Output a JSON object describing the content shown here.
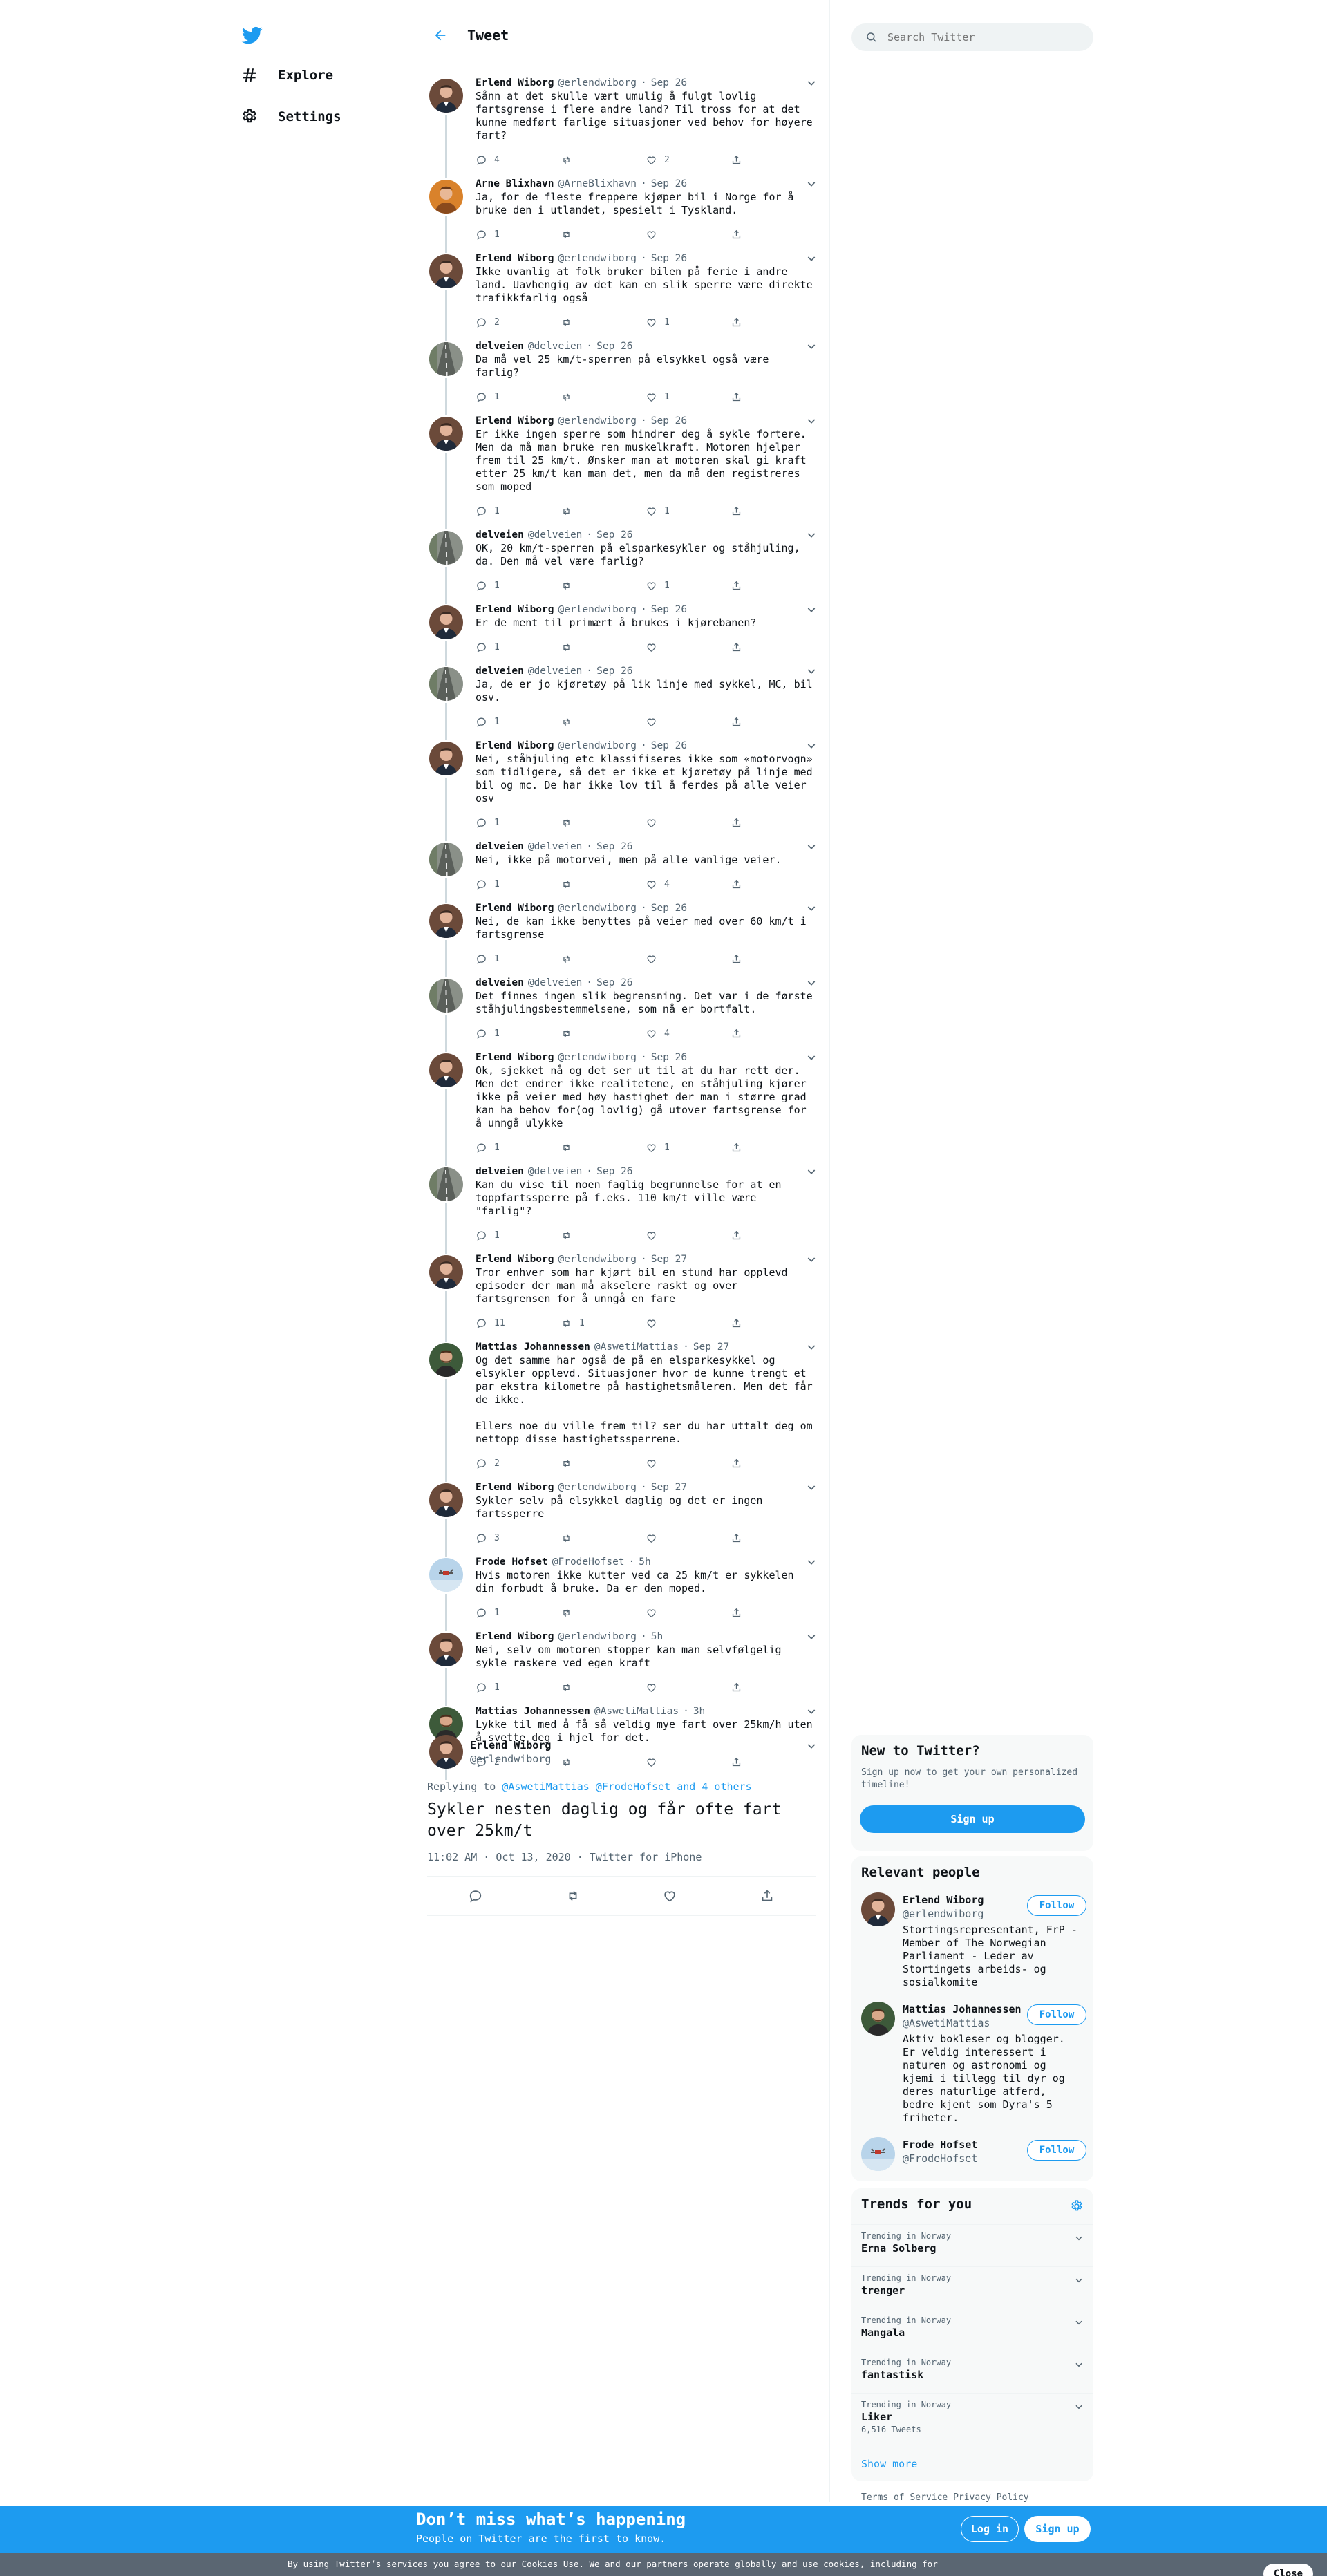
{
  "nav": {
    "explore": "Explore",
    "settings": "Settings"
  },
  "header": {
    "title": "Tweet"
  },
  "colors": {
    "accent": "#1d9bf0",
    "text": "#0f1419",
    "muted": "#536471",
    "banner": "#1d9bf0",
    "cookie_bar": "#5a6672"
  },
  "thread": [
    {
      "name": "Erlend Wiborg",
      "handle": "@erlendwiborg",
      "time": "Sep 26",
      "avatar": "suit",
      "text": "Sånn at det skulle vært umulig å fulgt lovlig fartsgrense i flere andre land? Til tross for at det kunne medført farlige situasjoner ved behov for høyere fart?",
      "replies": "4",
      "retweets": "",
      "likes": "2"
    },
    {
      "name": "Arne Blixhavn",
      "handle": "@ArneBlixhavn",
      "time": "Sep 26",
      "avatar": "orange",
      "text": "Ja, for de fleste freppere kjøper bil i Norge for å bruke den i utlandet, spesielt i Tyskland.",
      "replies": "1",
      "retweets": "",
      "likes": ""
    },
    {
      "name": "Erlend Wiborg",
      "handle": "@erlendwiborg",
      "time": "Sep 26",
      "avatar": "suit",
      "text": "Ikke uvanlig at folk bruker bilen på ferie i andre land. Uavhengig av det kan en slik sperre være direkte trafikkfarlig også",
      "replies": "2",
      "retweets": "",
      "likes": "1"
    },
    {
      "name": "delveien",
      "handle": "@delveien",
      "time": "Sep 26",
      "avatar": "road",
      "text": "Da må vel 25 km/t-sperren på elsykkel også være farlig?",
      "replies": "1",
      "retweets": "",
      "likes": "1"
    },
    {
      "name": "Erlend Wiborg",
      "handle": "@erlendwiborg",
      "time": "Sep 26",
      "avatar": "suit",
      "text": "Er ikke ingen sperre som hindrer deg å sykle fortere. Men da må man bruke ren muskelkraft. Motoren hjelper frem til 25 km/t. Ønsker man at motoren skal gi kraft etter 25 km/t kan man det, men da må den registreres som moped",
      "replies": "1",
      "retweets": "",
      "likes": "1"
    },
    {
      "name": "delveien",
      "handle": "@delveien",
      "time": "Sep 26",
      "avatar": "road",
      "text": "OK, 20 km/t-sperren på elsparkesykler og ståhjuling, da. Den må vel være farlig?",
      "replies": "1",
      "retweets": "",
      "likes": "1"
    },
    {
      "name": "Erlend Wiborg",
      "handle": "@erlendwiborg",
      "time": "Sep 26",
      "avatar": "suit",
      "text": "Er de ment til primært å brukes i kjørebanen?",
      "replies": "1",
      "retweets": "",
      "likes": ""
    },
    {
      "name": "delveien",
      "handle": "@delveien",
      "time": "Sep 26",
      "avatar": "road",
      "text": "Ja, de er jo kjøretøy på lik linje med sykkel, MC, bil osv.",
      "replies": "1",
      "retweets": "",
      "likes": ""
    },
    {
      "name": "Erlend Wiborg",
      "handle": "@erlendwiborg",
      "time": "Sep 26",
      "avatar": "suit",
      "text": "Nei, ståhjuling etc klassifiseres ikke som «motorvogn» som tidligere, så det er ikke et kjøretøy på linje med bil og mc. De har ikke lov til å ferdes på alle veier osv",
      "replies": "1",
      "retweets": "",
      "likes": ""
    },
    {
      "name": "delveien",
      "handle": "@delveien",
      "time": "Sep 26",
      "avatar": "road",
      "text": "Nei, ikke på motorvei, men på alle vanlige veier.",
      "replies": "1",
      "retweets": "",
      "likes": "4"
    },
    {
      "name": "Erlend Wiborg",
      "handle": "@erlendwiborg",
      "time": "Sep 26",
      "avatar": "suit",
      "text": "Nei, de kan ikke benyttes på veier med over 60 km/t i fartsgrense",
      "replies": "1",
      "retweets": "",
      "likes": ""
    },
    {
      "name": "delveien",
      "handle": "@delveien",
      "time": "Sep 26",
      "avatar": "road",
      "text": "Det finnes ingen slik begrensning. Det var i de første ståhjulingsbestemmelsene, som nå er bortfalt.",
      "replies": "1",
      "retweets": "",
      "likes": "4"
    },
    {
      "name": "Erlend Wiborg",
      "handle": "@erlendwiborg",
      "time": "Sep 26",
      "avatar": "suit",
      "text": "Ok, sjekket nå og det ser ut til at du har rett der. Men det endrer ikke realitetene, en ståhjuling kjører ikke på veier med høy hastighet der man i større grad kan ha behov for(og lovlig) gå utover fartsgrense for å unngå ulykke",
      "replies": "1",
      "retweets": "",
      "likes": "1"
    },
    {
      "name": "delveien",
      "handle": "@delveien",
      "time": "Sep 26",
      "avatar": "road",
      "text": "Kan du vise til noen faglig begrunnelse for at en toppfartssperre på f.eks. 110 km/t ville være \"farlig\"?",
      "replies": "1",
      "retweets": "",
      "likes": ""
    },
    {
      "name": "Erlend Wiborg",
      "handle": "@erlendwiborg",
      "time": "Sep 27",
      "avatar": "suit",
      "text": "Tror enhver som har kjørt bil en stund har opplevd episoder der man må akselere raskt og over fartsgrensen for å unngå en fare",
      "replies": "11",
      "retweets": "1",
      "likes": ""
    },
    {
      "name": "Mattias Johannessen",
      "handle": "@AswetiMattias",
      "time": "Sep 27",
      "avatar": "beard",
      "text": "Og det samme har også de på en elsparkesykkel og elsykler opplevd. Situasjoner hvor de kunne trengt et par ekstra kilometre på hastighetsmåleren. Men det får de ikke.\n\nEllers noe du ville frem til? ser du har uttalt deg om nettopp disse hastighetssperrene.",
      "replies": "2",
      "retweets": "",
      "likes": ""
    },
    {
      "name": "Erlend Wiborg",
      "handle": "@erlendwiborg",
      "time": "Sep 27",
      "avatar": "suit",
      "text": "Sykler selv på elsykkel daglig og det er ingen fartssperre",
      "replies": "3",
      "retweets": "",
      "likes": ""
    },
    {
      "name": "Frode Hofset",
      "handle": "@FrodeHofset",
      "time": "5h",
      "avatar": "drone",
      "text": "Hvis motoren ikke kutter ved ca 25 km/t er sykkelen din forbudt å bruke. Da er den moped.",
      "replies": "1",
      "retweets": "",
      "likes": ""
    },
    {
      "name": "Erlend Wiborg",
      "handle": "@erlendwiborg",
      "time": "5h",
      "avatar": "suit",
      "text": "Nei, selv om motoren stopper kan man selvfølgelig sykle raskere ved egen kraft",
      "replies": "1",
      "retweets": "",
      "likes": ""
    },
    {
      "name": "Mattias Johannessen",
      "handle": "@AswetiMattias",
      "time": "3h",
      "avatar": "beard",
      "text": "Lykke til med å få så veldig mye fart over 25km/h uten å svette deg i hjel for det.",
      "replies": "2",
      "retweets": "",
      "likes": ""
    }
  ],
  "main_tweet": {
    "name": "Erlend Wiborg",
    "handle": "@erlendwiborg",
    "replying_prefix": "Replying to",
    "replying_to": "@AswetiMattias @FrodeHofset and 4 others",
    "text": "Sykler nesten daglig og får ofte fart over 25km/t",
    "timestamp": "11:02 AM · Oct 13, 2020 · Twitter for iPhone"
  },
  "search": {
    "placeholder": "Search Twitter"
  },
  "new_to_twitter": {
    "title": "New to Twitter?",
    "text": "Sign up now to get your own personalized timeline!",
    "button": "Sign up"
  },
  "relevant_people": {
    "title": "Relevant people",
    "follow_label": "Follow",
    "people": [
      {
        "name": "Erlend Wiborg",
        "handle": "@erlendwiborg",
        "bio": "Stortingsrepresentant, FrP - Member of The Norwegian Parliament - Leder av Stortingets arbeids- og sosialkomite"
      },
      {
        "name": "Mattias Johannessen",
        "handle": "@AswetiMattias",
        "bio": "Aktiv bokleser og blogger. Er veldig interessert i naturen og astronomi og kjemi i tillegg til dyr og deres naturlige atferd, bedre kjent som Dyra's 5 friheter."
      },
      {
        "name": "Frode Hofset",
        "handle": "@FrodeHofset",
        "bio": ""
      }
    ]
  },
  "trends": {
    "title": "Trends for you",
    "items": [
      {
        "location": "Trending in Norway",
        "name": "Erna Solberg",
        "count": ""
      },
      {
        "location": "Trending in Norway",
        "name": "trenger",
        "count": ""
      },
      {
        "location": "Trending in Norway",
        "name": "Mangala",
        "count": ""
      },
      {
        "location": "Trending in Norway",
        "name": "fantastisk",
        "count": ""
      },
      {
        "location": "Trending in Norway",
        "name": "Liker",
        "count": "6,516 Tweets"
      }
    ],
    "show_more": "Show more"
  },
  "footer": {
    "terms": "Terms of Service",
    "privacy": "Privacy Policy"
  },
  "banner": {
    "title": "Don’t miss what’s happening",
    "subtitle": "People on Twitter are the first to know.",
    "login": "Log in",
    "signup": "Sign up"
  },
  "cookie": {
    "text_before": "By using Twitter’s services you agree to our ",
    "link": "Cookies Use",
    "text_after": ". We and our partners operate globally and use cookies, including for",
    "close": "Close"
  }
}
